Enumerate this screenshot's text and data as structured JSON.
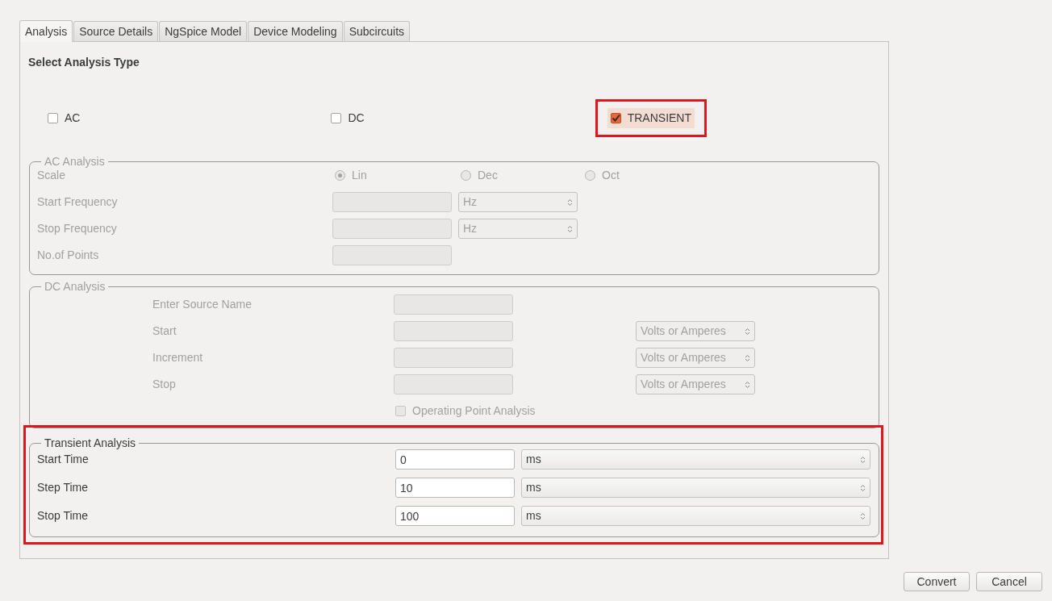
{
  "tabs": [
    {
      "label": "Analysis",
      "selected": true
    },
    {
      "label": "Source Details",
      "selected": false
    },
    {
      "label": "NgSpice Model",
      "selected": false
    },
    {
      "label": "Device Modeling",
      "selected": false
    },
    {
      "label": "Subcircuits",
      "selected": false
    }
  ],
  "analysis_type": {
    "heading": "Select Analysis Type",
    "options": [
      {
        "label": "AC",
        "checked": false,
        "highlighted": false
      },
      {
        "label": "DC",
        "checked": false,
        "highlighted": false
      },
      {
        "label": "TRANSIENT",
        "checked": true,
        "highlighted": true
      }
    ]
  },
  "ac_analysis": {
    "title": "AC Analysis",
    "disabled": true,
    "scale": {
      "label": "Scale",
      "options": [
        {
          "label": "Lin",
          "selected": true
        },
        {
          "label": "Dec",
          "selected": false
        },
        {
          "label": "Oct",
          "selected": false
        }
      ]
    },
    "rows": [
      {
        "label": "Start Frequency",
        "unit": "Hz"
      },
      {
        "label": "Stop Frequency",
        "unit": "Hz"
      },
      {
        "label": "No.of Points"
      }
    ]
  },
  "dc_analysis": {
    "title": "DC Analysis",
    "disabled": true,
    "rows": [
      {
        "label": "Enter Source Name"
      },
      {
        "label": "Start",
        "unit": "Volts or Amperes"
      },
      {
        "label": "Increment",
        "unit": "Volts or Amperes"
      },
      {
        "label": "Stop",
        "unit": "Volts or Amperes"
      }
    ],
    "operating_point": {
      "label": "Operating Point Analysis",
      "checked": false
    }
  },
  "transient_analysis": {
    "title": "Transient Analysis",
    "disabled": false,
    "highlighted": true,
    "rows": [
      {
        "label": "Start Time",
        "value": "0",
        "unit": "ms"
      },
      {
        "label": "Step Time",
        "value": "10",
        "unit": "ms"
      },
      {
        "label": "Stop Time",
        "value": "100",
        "unit": "ms"
      }
    ]
  },
  "buttons": [
    "Convert",
    "Cancel"
  ]
}
